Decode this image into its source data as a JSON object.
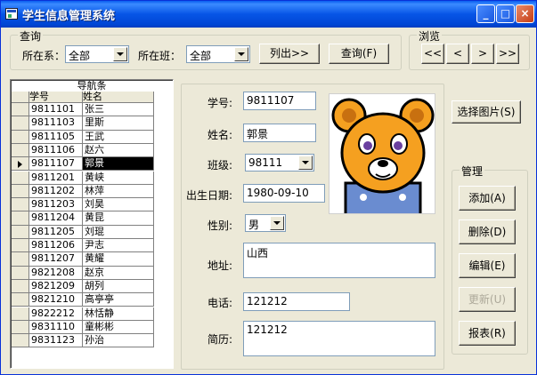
{
  "window": {
    "title": "学生信息管理系统"
  },
  "query": {
    "group_label": "查询",
    "dept_label": "所在系：",
    "dept_value": "全部",
    "class_label": "所在班：",
    "class_value": "全部",
    "list_button": "列出>>",
    "query_button": "查询(F)"
  },
  "browse": {
    "group_label": "浏览",
    "first": "<<",
    "prev": "<",
    "next": ">",
    "last": ">>"
  },
  "nav_grid": {
    "caption": "导航条",
    "columns": [
      "学号",
      "姓名"
    ],
    "rows": [
      {
        "id": "9811101",
        "name": "张三"
      },
      {
        "id": "9811103",
        "name": "里斯"
      },
      {
        "id": "9811105",
        "name": "王武"
      },
      {
        "id": "9811106",
        "name": "赵六"
      },
      {
        "id": "9811107",
        "name": "郭景"
      },
      {
        "id": "9811201",
        "name": "黄峡"
      },
      {
        "id": "9811202",
        "name": "林萍"
      },
      {
        "id": "9811203",
        "name": "刘昊"
      },
      {
        "id": "9811204",
        "name": "黄昆"
      },
      {
        "id": "9811205",
        "name": "刘琨"
      },
      {
        "id": "9811206",
        "name": "尹志"
      },
      {
        "id": "9811207",
        "name": "黄耀"
      },
      {
        "id": "9821208",
        "name": "赵京"
      },
      {
        "id": "9821209",
        "name": "胡列"
      },
      {
        "id": "9821210",
        "name": "高亭亭"
      },
      {
        "id": "9822212",
        "name": "林恬静"
      },
      {
        "id": "9831110",
        "name": "童彬彬"
      },
      {
        "id": "9831123",
        "name": "孙治"
      }
    ],
    "current_index": 4
  },
  "form": {
    "student_id_label": "学号:",
    "student_id": "9811107",
    "name_label": "姓名:",
    "name": "郭景",
    "class_label": "班级:",
    "class": "98111",
    "birth_label": "出生日期:",
    "birth": "1980-09-10",
    "gender_label": "性别:",
    "gender": "男",
    "address_label": "地址:",
    "address": "山西",
    "phone_label": "电话:",
    "phone": "121212",
    "resume_label": "简历:",
    "resume": "121212"
  },
  "photo": {
    "select_button": "选择图片(S)",
    "icon": "bear-photo"
  },
  "manage": {
    "group_label": "管理",
    "add": "添加(A)",
    "delete": "删除(D)",
    "edit": "编辑(E)",
    "update": "更新(U)",
    "report": "报表(R)"
  },
  "colors": {
    "title_bar": "#0054e3",
    "window_bg": "#ece9d8",
    "close_button": "#d9461b",
    "selection": "#000000"
  }
}
